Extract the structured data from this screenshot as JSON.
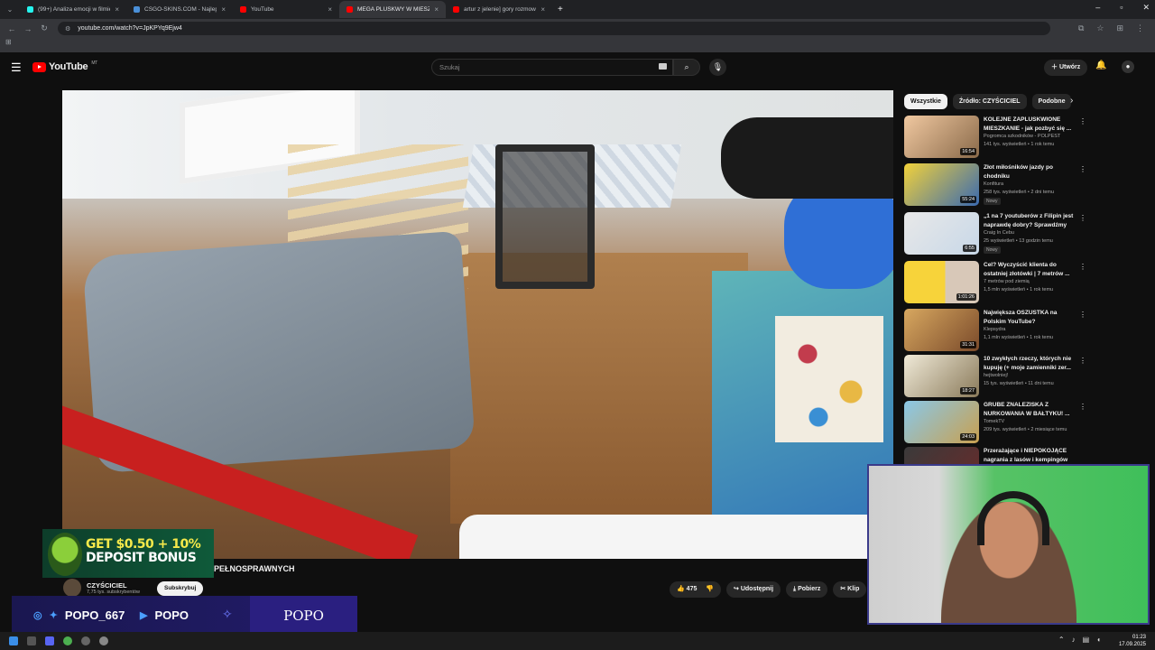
{
  "browser": {
    "tabs": [
      {
        "label": "(99+) Analiza emocji w filmie -",
        "color": "#25f4ee",
        "active": false
      },
      {
        "label": "CSGO-SKINS.COM - Najlepsze",
        "color": "#4a90d9",
        "active": false
      },
      {
        "label": "YouTube",
        "color": "#ff0000",
        "active": false
      },
      {
        "label": "MEGA PLUSKWY W MIESZ",
        "color": "#ff0000",
        "active": true
      },
      {
        "label": "artur z jelenie] gory rozmowa z",
        "color": "#ff0000",
        "active": false
      }
    ],
    "new_tab": "+",
    "url": "youtube.com/watch?v=JpKPYq9Ejw4"
  },
  "youtube": {
    "logo": "YouTube",
    "region": "MT",
    "search_placeholder": "Szukaj",
    "create_label": "Utwórz"
  },
  "video": {
    "title": "PEŁNOSPRAWNYCH",
    "channel": "CZYŚCICIEL",
    "subscribers": "7,75 tys. subskrybentów",
    "subscribe_label": "Subskrybuj",
    "likes": "475",
    "share_label": "Udostępnij",
    "download_label": "Pobierz",
    "clip_label": "Klip"
  },
  "chips": [
    "Wszystkie",
    "Źródło: CZYŚCICIEL",
    "Podobne"
  ],
  "recommendations": [
    {
      "title": "KOLEJNE ZAPLUSKWIONE MIESZKANIE - jak pozbyć się ...",
      "channel": "Pogromca szkodników - POLPEST",
      "meta": "141 tys. wyświetleń • 1 rok temu",
      "duration": "16:54",
      "thumb": "#8a6a4a",
      "badge": ""
    },
    {
      "title": "Złot miłośników jazdy po chodniku",
      "channel": "Konfitura",
      "meta": "258 tys. wyświetleń • 2 dni temu",
      "duration": "55:24",
      "thumb": "#3a6ab0",
      "badge": "Nowy"
    },
    {
      "title": "„1 na 7 youtuberów z Filipin jest naprawdę dobry? Sprawdźmy t...",
      "channel": "Craig In Cebu",
      "meta": "25 wyświetleń • 13 godzin temu",
      "duration": "6:55",
      "thumb": "#c8d8e8",
      "badge": "Nowy"
    },
    {
      "title": "Cel? Wyczyścić klienta do ostatniej złotówki | 7 metrów ...",
      "channel": "7 metrów pod ziemią",
      "meta": "1,5 mln wyświetleń • 1 rok temu",
      "duration": "1:01:26",
      "thumb": "#e8c23a",
      "badge": ""
    },
    {
      "title": "Największa OSZUSTKA na Polskim YouTube?",
      "channel": "Klepsydra",
      "meta": "1,1 mln wyświetleń • 1 rok temu",
      "duration": "31:31",
      "thumb": "#b8863a",
      "badge": ""
    },
    {
      "title": "10 zwykłych rzeczy, których nie kupuję (+ moje zamienniki zer...",
      "channel": "hejtwolniej!",
      "meta": "15 tys. wyświetleń • 11 dni temu",
      "duration": "18:27",
      "thumb": "#d8d0b8",
      "badge": ""
    },
    {
      "title": "GRUBE ZNALEZISKA Z NURKOWANIA W BAŁTYKU! ...",
      "channel": "TomekTV",
      "meta": "209 tys. wyświetleń • 2 miesiące temu",
      "duration": "24:03",
      "thumb": "#4a8ab8",
      "badge": ""
    },
    {
      "title": "Przerażające i NIEPOKOJĄCE nagrania z lasów i kempingów",
      "channel": "",
      "meta": "",
      "duration": "",
      "thumb": "#3a3a3a",
      "badge": ""
    }
  ],
  "ad": {
    "line1": "GET $0.50 + 10%",
    "line2": "DEPOSIT BONUS"
  },
  "stream_overlay": {
    "handle1": "POPO_667",
    "handle2": "POPO",
    "brand": "POPO"
  },
  "taskbar": {
    "time": "01:23",
    "date": "17.09.2025"
  }
}
